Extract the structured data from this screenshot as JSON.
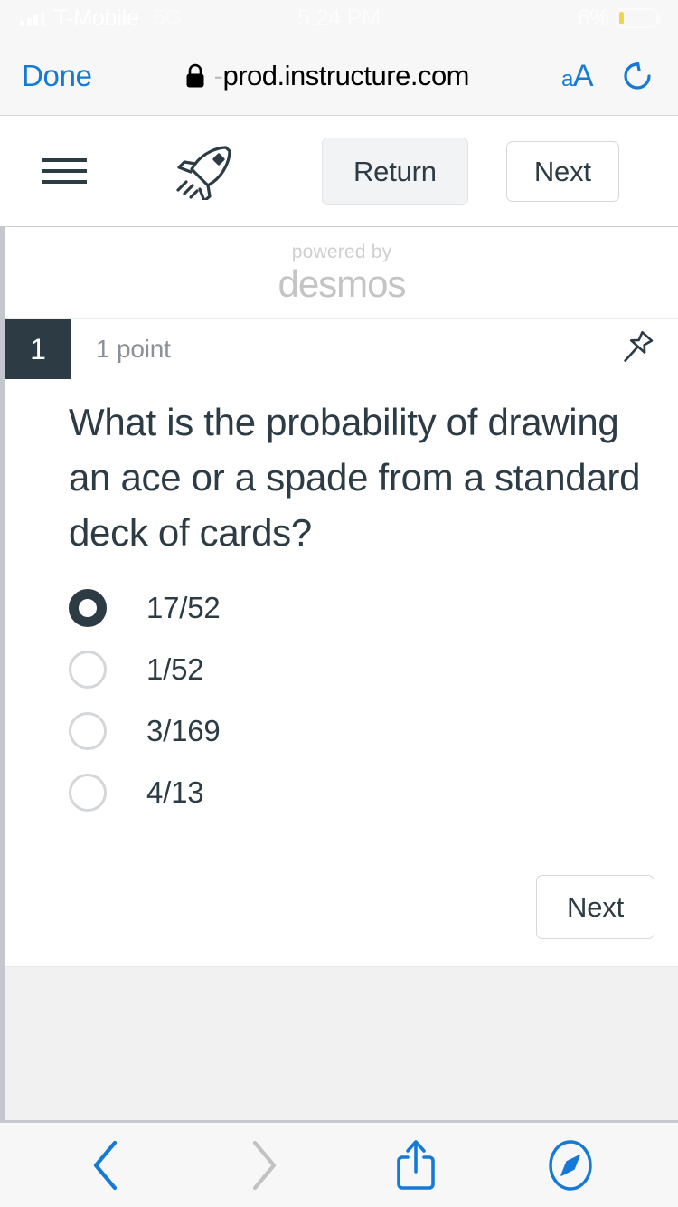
{
  "status_bar": {
    "carrier": "T-Mobile",
    "network": "5G",
    "time": "5:24 PM",
    "battery_percent": "6%",
    "battery_level": 6,
    "signal_icon": "cellular-signal-icon",
    "battery_icon": "battery-low-icon",
    "battery_color": "#f0d44a"
  },
  "browser": {
    "done_label": "Done",
    "lock_icon": "lock-icon",
    "url_prefix": "-",
    "url": "prod.instructure.com",
    "url_full": "-prod.instructure.com",
    "text_size_small": "a",
    "text_size_large": "A",
    "text_size_icon": "text-size-aa-icon",
    "reload_icon": "reload-icon",
    "accent_color": "#1579d6"
  },
  "quiz_toolbar": {
    "menu_icon": "hamburger-menu-icon",
    "rocket_icon": "rocket-icon",
    "return_label": "Return",
    "next_label": "Next"
  },
  "desmos": {
    "powered_by": "powered by",
    "wordmark": "desmos"
  },
  "question": {
    "number": "1",
    "points": "1 point",
    "pin_icon": "pushpin-icon",
    "text": "What is the probability of drawing an ace or a spade from a standard deck of cards?",
    "selected_index": 0,
    "choices": [
      {
        "label": "17/52",
        "selected": true
      },
      {
        "label": "1/52",
        "selected": false
      },
      {
        "label": "3/169",
        "selected": false
      },
      {
        "label": "4/13",
        "selected": false
      }
    ],
    "next_label": "Next",
    "accent_color": "#2d3b45"
  },
  "bottom_bar": {
    "back_icon": "back-chevron-icon",
    "forward_icon": "forward-chevron-icon",
    "share_icon": "share-icon",
    "tabs_icon": "safari-compass-icon",
    "back_enabled": true,
    "forward_enabled": false
  }
}
